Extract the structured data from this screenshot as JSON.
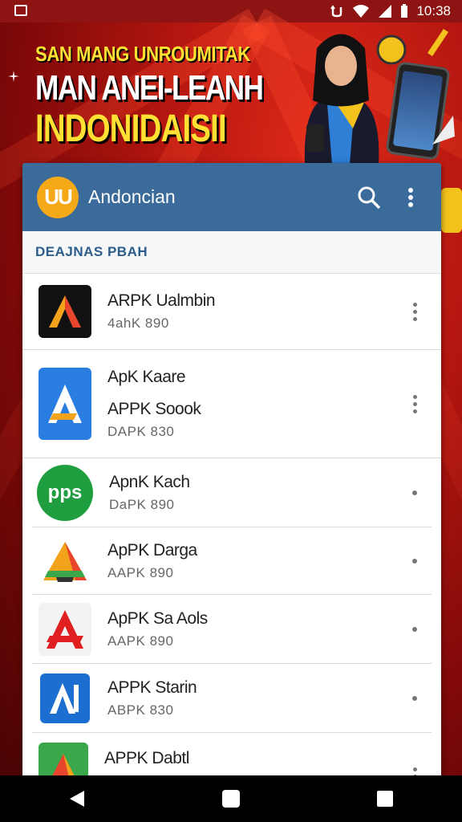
{
  "status_bar": {
    "time": "10:38",
    "icons": [
      "app-notification-icon",
      "sync-icon",
      "wifi-icon",
      "signal-icon",
      "battery-icon"
    ]
  },
  "banner": {
    "line1": "SAN MANG UNROUMITAK",
    "line2": "MAN ANEI-LEANH",
    "line3": "INDONIDAISII"
  },
  "app_bar": {
    "logo_text": "UU",
    "title": "Andoncian"
  },
  "section": {
    "header": "DEAJNAS PBAH"
  },
  "apps": [
    {
      "name": "ARPK Ualmbin",
      "name2": "",
      "meta": "4ahK   890",
      "icon": "apk-arrow-red-icon",
      "color": "#e8452c"
    },
    {
      "name": "ApK Kaare",
      "name2": "APPK Soook",
      "meta": "DAPK   830",
      "icon": "apk-a-blue-icon",
      "color": "#2a7de1"
    },
    {
      "name": "ApnK Kach",
      "name2": "",
      "meta": "DaPK   890",
      "icon": "pps-green-icon",
      "color": "#1e9e3f"
    },
    {
      "name": "ApPK Darga",
      "name2": "",
      "meta": "AAPK   890",
      "icon": "apk-a-orange-icon",
      "color": "#f2a21b"
    },
    {
      "name": "ApPK Sa Aols",
      "name2": "",
      "meta": "AAPK   890",
      "icon": "apk-a-red-icon",
      "color": "#e02020"
    },
    {
      "name": "APPK Starin",
      "name2": "",
      "meta": "ABPK   830",
      "icon": "apk-al-blue-icon",
      "color": "#1c6fd1"
    },
    {
      "name": "APPK Dabtl",
      "name2": "",
      "meta": "",
      "icon": "apk-a-green-icon",
      "color": "#3aa84a"
    }
  ],
  "nav": {
    "icons": [
      "back-icon",
      "home-icon",
      "recents-icon"
    ]
  },
  "colors": {
    "accent": "#3a6b9a",
    "banner_red": "#b3160f",
    "banner_yellow": "#ffe033",
    "logo": "#f5a818"
  }
}
